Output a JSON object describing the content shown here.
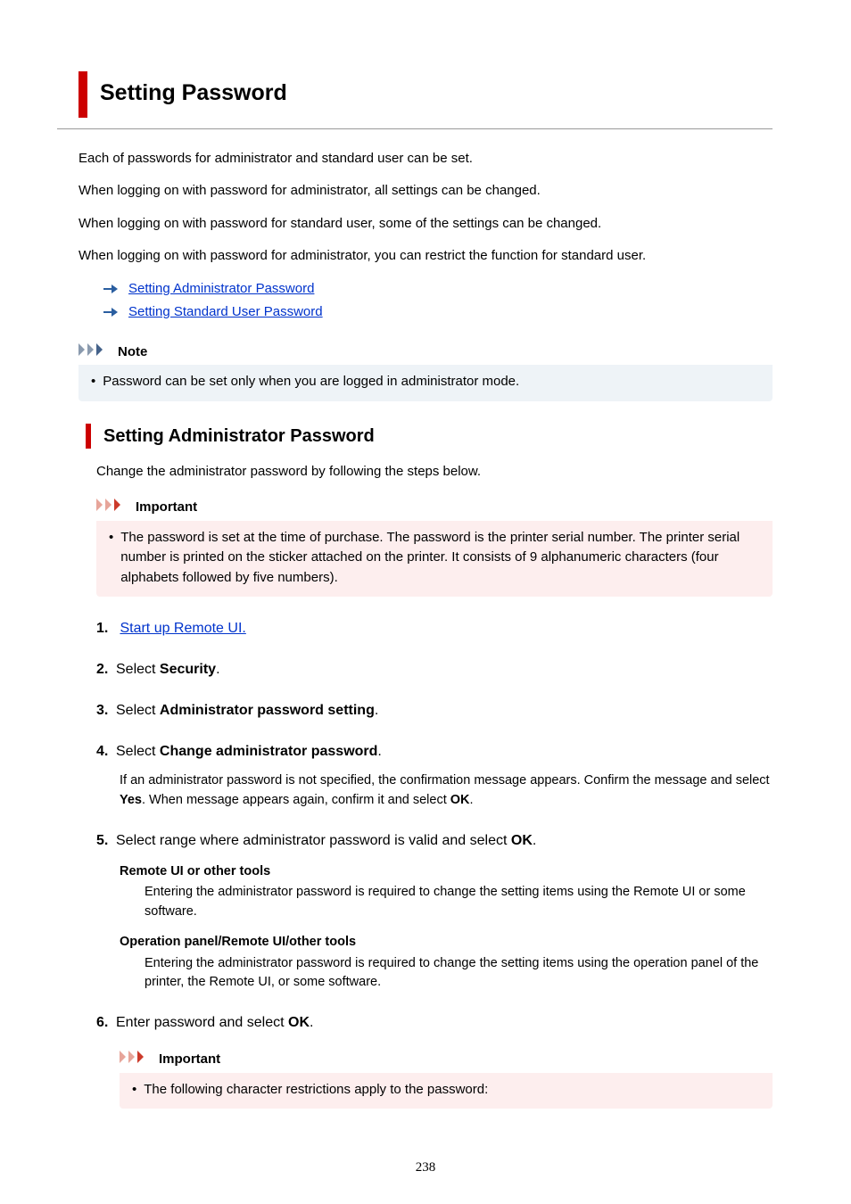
{
  "h1": "Setting Password",
  "intro": [
    "Each of passwords for administrator and standard user can be set.",
    "When logging on with password for administrator, all settings can be changed.",
    "When logging on with password for standard user, some of the settings can be changed.",
    "When logging on with password for administrator, you can restrict the function for standard user."
  ],
  "links": {
    "admin": "Setting Administrator Password",
    "standard": "Setting Standard User Password"
  },
  "note": {
    "title": "Note",
    "text": "Password can be set only when you are logged in administrator mode."
  },
  "section": {
    "title": "Setting Administrator Password",
    "lead": "Change the administrator password by following the steps below."
  },
  "important1": {
    "title": "Important",
    "text": "The password is set at the time of purchase. The password is the printer serial number. The printer serial number is printed on the sticker attached on the printer. It consists of 9 alphanumeric characters (four alphabets followed by five numbers)."
  },
  "steps": {
    "s1": {
      "num": "1.",
      "link": "Start up Remote UI."
    },
    "s2": {
      "num": "2.",
      "pre": "Select ",
      "bold": "Security",
      "post": "."
    },
    "s3": {
      "num": "3.",
      "pre": "Select ",
      "bold": "Administrator password setting",
      "post": "."
    },
    "s4": {
      "num": "4.",
      "pre": "Select ",
      "bold": "Change administrator password",
      "post": ".",
      "body_a": "If an administrator password is not specified, the confirmation message appears. Confirm the message and select ",
      "body_b": "Yes",
      "body_c": ". When message appears again, confirm it and select ",
      "body_d": "OK",
      "body_e": "."
    },
    "s5": {
      "num": "5.",
      "pre": "Select range where administrator password is valid and select ",
      "bold": "OK",
      "post": ".",
      "opt1_term": "Remote UI or other tools",
      "opt1_body": "Entering the administrator password is required to change the setting items using the Remote UI or some software.",
      "opt2_term": "Operation panel/Remote UI/other tools",
      "opt2_body": "Entering the administrator password is required to change the setting items using the operation panel of the printer, the Remote UI, or some software."
    },
    "s6": {
      "num": "6.",
      "pre": "Enter password and select ",
      "bold": "OK",
      "post": "."
    }
  },
  "important2": {
    "title": "Important",
    "text": "The following character restrictions apply to the password:"
  },
  "page_number": "238"
}
